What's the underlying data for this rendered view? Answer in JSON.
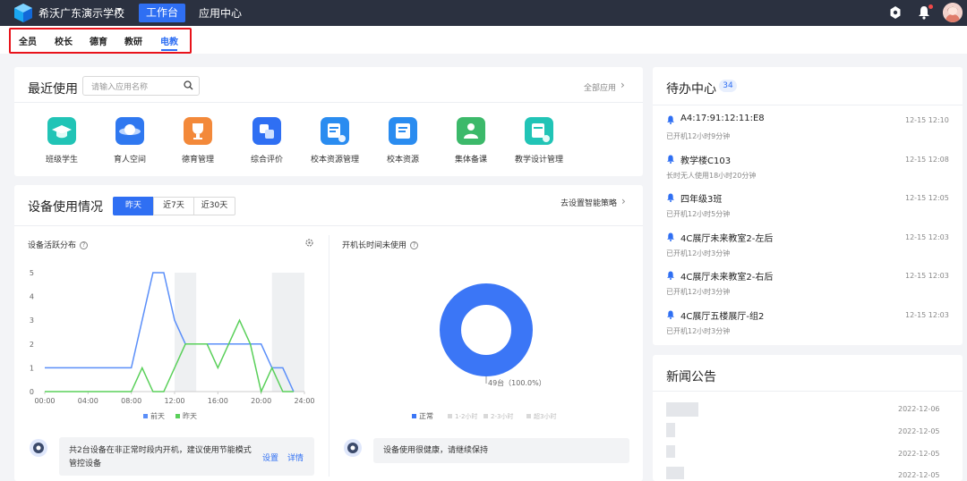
{
  "topbar": {
    "school_name": "希沃广东演示学校",
    "nav": [
      "工作台",
      "应用中心"
    ]
  },
  "roles": [
    "全员",
    "校长",
    "德育",
    "教研",
    "电教"
  ],
  "recent": {
    "title": "最近使用",
    "search_placeholder": "请输入应用名称",
    "all_apps": "全部应用",
    "apps": [
      {
        "label": "班级学生",
        "icon": "graduation-cap-icon",
        "color": "#21c4b6"
      },
      {
        "label": "育人空间",
        "icon": "planet-icon",
        "color": "#2f78f0"
      },
      {
        "label": "德育管理",
        "icon": "trophy-icon",
        "color": "#f3893a"
      },
      {
        "label": "综合评价",
        "icon": "evaluation-icon",
        "color": "#2f6ff3"
      },
      {
        "label": "校本资源管理",
        "icon": "resource-manage-icon",
        "color": "#2a8cf0"
      },
      {
        "label": "校本资源",
        "icon": "resource-icon",
        "color": "#2a8cf0"
      },
      {
        "label": "集体备课",
        "icon": "group-prep-icon",
        "color": "#3cb96a"
      },
      {
        "label": "教学设计管理",
        "icon": "design-manage-icon",
        "color": "#21c4b6"
      }
    ]
  },
  "usage": {
    "title": "设备使用情况",
    "tabs": [
      "昨天",
      "近7天",
      "近30天"
    ],
    "strategy_link": "去设置智能策略",
    "activity_title": "设备活跃分布",
    "idle_title": "开机长时间未使用",
    "activity_tip": "共2台设备在非正常时段内开机，建议使用节能模式管控设备",
    "activity_tip_links": [
      "设置",
      "详情"
    ],
    "idle_tip": "设备使用很健康，请继续保持"
  },
  "chart_data": [
    {
      "type": "line",
      "x": [
        "00:00",
        "01:00",
        "02:00",
        "03:00",
        "04:00",
        "05:00",
        "06:00",
        "07:00",
        "08:00",
        "09:00",
        "10:00",
        "11:00",
        "12:00",
        "13:00",
        "14:00",
        "15:00",
        "16:00",
        "17:00",
        "18:00",
        "19:00",
        "20:00",
        "21:00",
        "22:00",
        "23:00",
        "24:00"
      ],
      "xticks": [
        "00:00",
        "04:00",
        "08:00",
        "12:00",
        "16:00",
        "20:00",
        "24:00"
      ],
      "yticks": [
        "0",
        "1",
        "2",
        "3",
        "4",
        "5"
      ],
      "ylim": [
        0,
        5
      ],
      "series": [
        {
          "name": "前天",
          "color": "#5b8ff9",
          "values": [
            1,
            1,
            1,
            1,
            1,
            1,
            1,
            1,
            1,
            3,
            5,
            5,
            3,
            2,
            2,
            2,
            2,
            2,
            2,
            2,
            2,
            1,
            1,
            0,
            null
          ]
        },
        {
          "name": "昨天",
          "color": "#5ad05a",
          "values": [
            0,
            0,
            0,
            0,
            0,
            0,
            0,
            0,
            0,
            1,
            0,
            0,
            1,
            2,
            2,
            2,
            1,
            2,
            3,
            2,
            0,
            1,
            0,
            0,
            null
          ]
        }
      ],
      "highlight_bands": [
        [
          12,
          14
        ],
        [
          21,
          24
        ]
      ]
    },
    {
      "type": "pie",
      "values": [
        49,
        0,
        0,
        0
      ],
      "categories": [
        "正常",
        "1-2小时",
        "2-3小时",
        "超3小时"
      ],
      "colors": [
        "#3b76f6",
        "#d9d9d9",
        "#d9d9d9",
        "#d9d9d9"
      ],
      "slice_label": "49台（100.0%）"
    }
  ],
  "todo": {
    "title": "待办中心",
    "count": "34",
    "items": [
      {
        "title": "A4:17:91:12:11:E8",
        "time": "12-15 12:10",
        "sub": "已开机12小时9分钟"
      },
      {
        "title": "教学楼C103",
        "time": "12-15 12:08",
        "sub": "长时无人使用18小时20分钟"
      },
      {
        "title": "四年级3班",
        "time": "12-15 12:05",
        "sub": "已开机12小时5分钟"
      },
      {
        "title": "4C展厅未来教室2-左后",
        "time": "12-15 12:03",
        "sub": "已开机12小时3分钟"
      },
      {
        "title": "4C展厅未来教室2-右后",
        "time": "12-15 12:03",
        "sub": "已开机12小时3分钟"
      },
      {
        "title": "4C展厅五楼展厅-组2",
        "time": "12-15 12:03",
        "sub": "已开机12小时3分钟"
      }
    ]
  },
  "news": {
    "title": "新闻公告",
    "dates": [
      "2022-12-06",
      "2022-12-05",
      "2022-12-05",
      "2022-12-05"
    ]
  }
}
